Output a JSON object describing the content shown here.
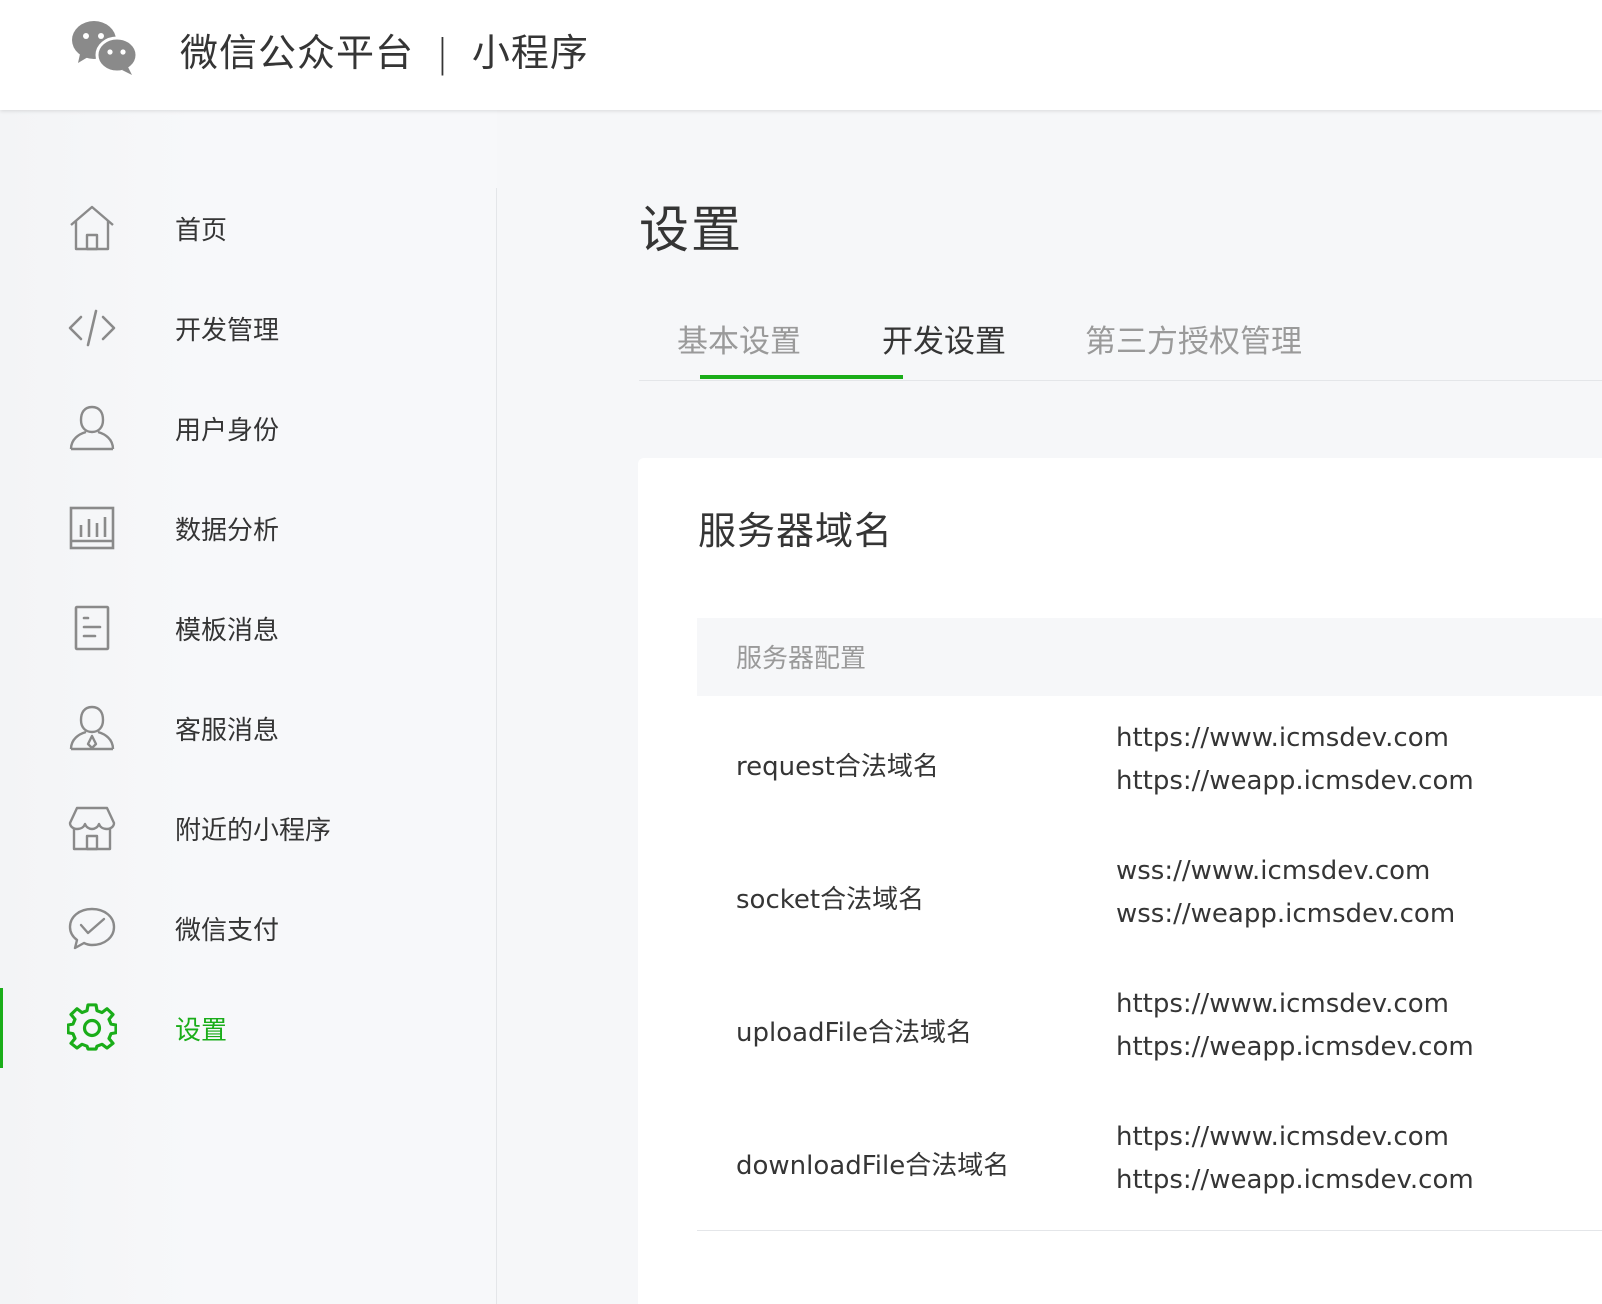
{
  "header": {
    "brand_main": "微信公众平台",
    "brand_sep": "|",
    "brand_sub": "小程序",
    "logo_icon": "wechat-logo-icon"
  },
  "sidebar": {
    "items": [
      {
        "label": "首页",
        "icon": "home-icon"
      },
      {
        "label": "开发管理",
        "icon": "code-icon"
      },
      {
        "label": "用户身份",
        "icon": "user-icon"
      },
      {
        "label": "数据分析",
        "icon": "chart-icon"
      },
      {
        "label": "模板消息",
        "icon": "document-icon"
      },
      {
        "label": "客服消息",
        "icon": "customer-service-icon"
      },
      {
        "label": "附近的小程序",
        "icon": "store-icon"
      },
      {
        "label": "微信支付",
        "icon": "wechat-pay-icon"
      },
      {
        "label": "设置",
        "icon": "gear-icon",
        "active": true
      }
    ]
  },
  "main": {
    "title": "设置",
    "tabs": [
      {
        "label": "基本设置"
      },
      {
        "label": "开发设置",
        "active": true
      },
      {
        "label": "第三方授权管理"
      }
    ],
    "card": {
      "title": "服务器域名",
      "section_header": "服务器配置",
      "rows": [
        {
          "label": "request合法域名",
          "values": [
            "https://www.icmsdev.com",
            "https://weapp.icmsdev.com"
          ]
        },
        {
          "label": "socket合法域名",
          "values": [
            "wss://www.icmsdev.com",
            "wss://weapp.icmsdev.com"
          ]
        },
        {
          "label": "uploadFile合法域名",
          "values": [
            "https://www.icmsdev.com",
            "https://weapp.icmsdev.com"
          ]
        },
        {
          "label": "downloadFile合法域名",
          "values": [
            "https://www.icmsdev.com",
            "https://weapp.icmsdev.com"
          ]
        }
      ]
    }
  },
  "colors": {
    "accent": "#1aad19",
    "text": "#353535",
    "muted": "#9a9a9a",
    "icon_gray": "#8a8a8a",
    "background": "#f6f7f9"
  }
}
